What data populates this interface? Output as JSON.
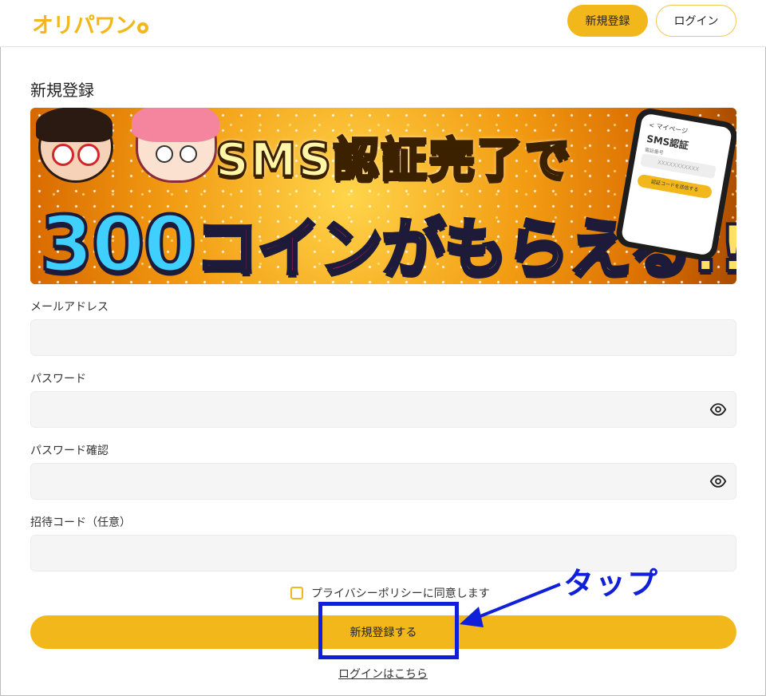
{
  "header": {
    "logo_text": "オリパワン",
    "register_label": "新規登録",
    "login_label": "ログイン"
  },
  "page_title": "新規登録",
  "banner": {
    "headline": "SMS認証完了で",
    "amount": "300",
    "coin_word": "コイン",
    "tail": "がもらえる!!!!",
    "phone": {
      "back_label": "< マイページ",
      "title": "SMS認証",
      "field_label": "電話番号",
      "field_value": "XXXXXXXXXXX",
      "send_label": "認証コードを送信する"
    }
  },
  "form": {
    "email_label": "メールアドレス",
    "email_value": "",
    "password_label": "パスワード",
    "password_value": "",
    "password_confirm_label": "パスワード確認",
    "password_confirm_value": "",
    "invite_label": "招待コード（任意）",
    "invite_value": "",
    "agree_label": "プライバシーポリシーに同意します",
    "agree_checked": false,
    "submit_label": "新規登録する",
    "login_link": "ログインはこちら"
  },
  "annotation": {
    "tap_label": "タップ",
    "color": "#1020d8"
  },
  "colors": {
    "accent": "#f2b81b",
    "input_bg": "#f5f5f5"
  }
}
